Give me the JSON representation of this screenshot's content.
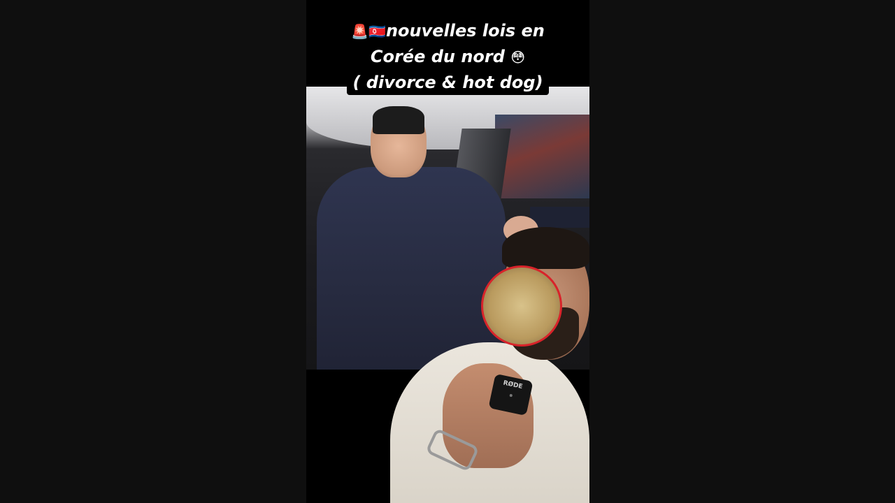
{
  "caption": {
    "line1_emojis": [
      "🚨",
      "🇰🇵"
    ],
    "line1_text": "nouvelles lois en",
    "line2_text": "Corée du nord",
    "line2_emoji": "😳",
    "line3_text": "( divorce & hot dog)"
  },
  "mic_label": "RØDE",
  "photo": {
    "alt": "",
    "icon": "photo-icon"
  },
  "colors": {
    "background": "#0f0f0f",
    "caption_bg": "#000000",
    "caption_text": "#ffffff",
    "inset_ring": "#d8232a"
  }
}
